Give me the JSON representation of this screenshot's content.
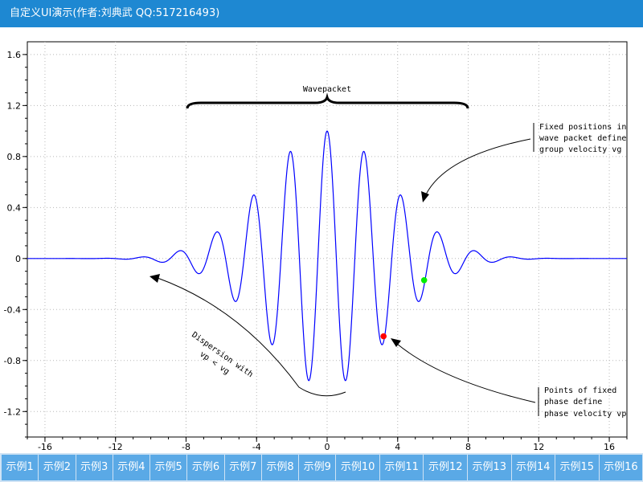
{
  "window": {
    "title": "自定义UI演示(作者:刘典武 QQ:517216493)"
  },
  "tabs": [
    "示例1",
    "示例2",
    "示例3",
    "示例4",
    "示例5",
    "示例6",
    "示例7",
    "示例8",
    "示例9",
    "示例10",
    "示例11",
    "示例12",
    "示例13",
    "示例14",
    "示例15",
    "示例16"
  ],
  "chart_data": {
    "type": "line",
    "title": "",
    "xlabel": "",
    "ylabel": "",
    "xlim": [
      -17,
      17
    ],
    "ylim": [
      -1.4,
      1.7
    ],
    "x_ticks": [
      -16,
      -12,
      -8,
      -4,
      0,
      4,
      8,
      12,
      16
    ],
    "y_ticks": [
      -1.2,
      -0.8,
      -0.4,
      0,
      0.4,
      0.8,
      1.2,
      1.6
    ],
    "x_tick_labels": [
      "-16",
      "-12",
      "-8",
      "-4",
      "0",
      "4",
      "8",
      "12",
      "16"
    ],
    "y_tick_labels": [
      "-1.2",
      "-0.8",
      "-0.4",
      "0",
      "0.4",
      "0.8",
      "1.2",
      "1.6"
    ],
    "grid": true,
    "series": [
      {
        "function": "exp(-0.04*x^2)*cos(3*x)",
        "x_range": [
          -17,
          17
        ],
        "color": "#0000ff"
      }
    ],
    "points": [
      {
        "x": 3.2,
        "y": -0.61,
        "color": "#ff0000"
      },
      {
        "x": 5.5,
        "y": -0.17,
        "color": "#00ee00"
      }
    ],
    "annotations": {
      "wavepacket": "Wavepacket",
      "group_velocity": [
        "Fixed positions in",
        "wave packet define",
        "group velocity vg"
      ],
      "phase_velocity": [
        "Points of fixed",
        "phase define",
        "phase velocity vp"
      ],
      "dispersion": [
        "Dispersion with",
        "vp < vg"
      ]
    }
  }
}
